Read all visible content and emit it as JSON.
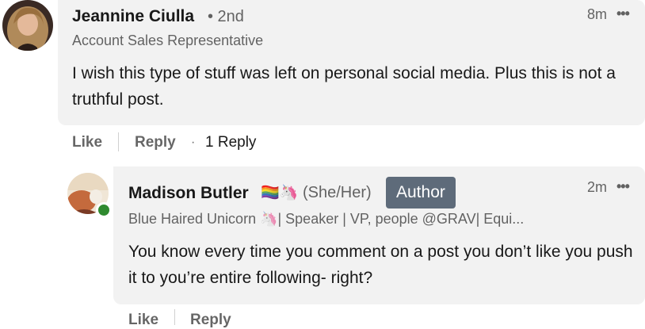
{
  "comment1": {
    "author": "Jeannine Ciulla",
    "degree": "• 2nd",
    "headline": "Account Sales Representative",
    "text": "I wish this type of stuff was left on personal social media. Plus this is not a truthful post.",
    "time": "8m",
    "more": "•••",
    "actions": {
      "like": "Like",
      "reply": "Reply",
      "dot": "·",
      "reply_count": "1 Reply"
    }
  },
  "reply1": {
    "author": "Madison Butler",
    "emoji": "🏳️‍🌈🦄",
    "pronouns": "(She/Her)",
    "badge": "Author",
    "headline": "Blue Haired Unicorn 🦄| Speaker | VP, people @GRAV| Equi...",
    "text": "You know every time you comment on a post you don’t like you push it to you’re entire following- right?",
    "time": "2m",
    "more": "•••",
    "actions": {
      "like": "Like",
      "reply": "Reply"
    }
  },
  "colors": {
    "bubble": "#f2f2f2",
    "badge": "#5e6b7a",
    "presence": "#2f8a2f"
  }
}
